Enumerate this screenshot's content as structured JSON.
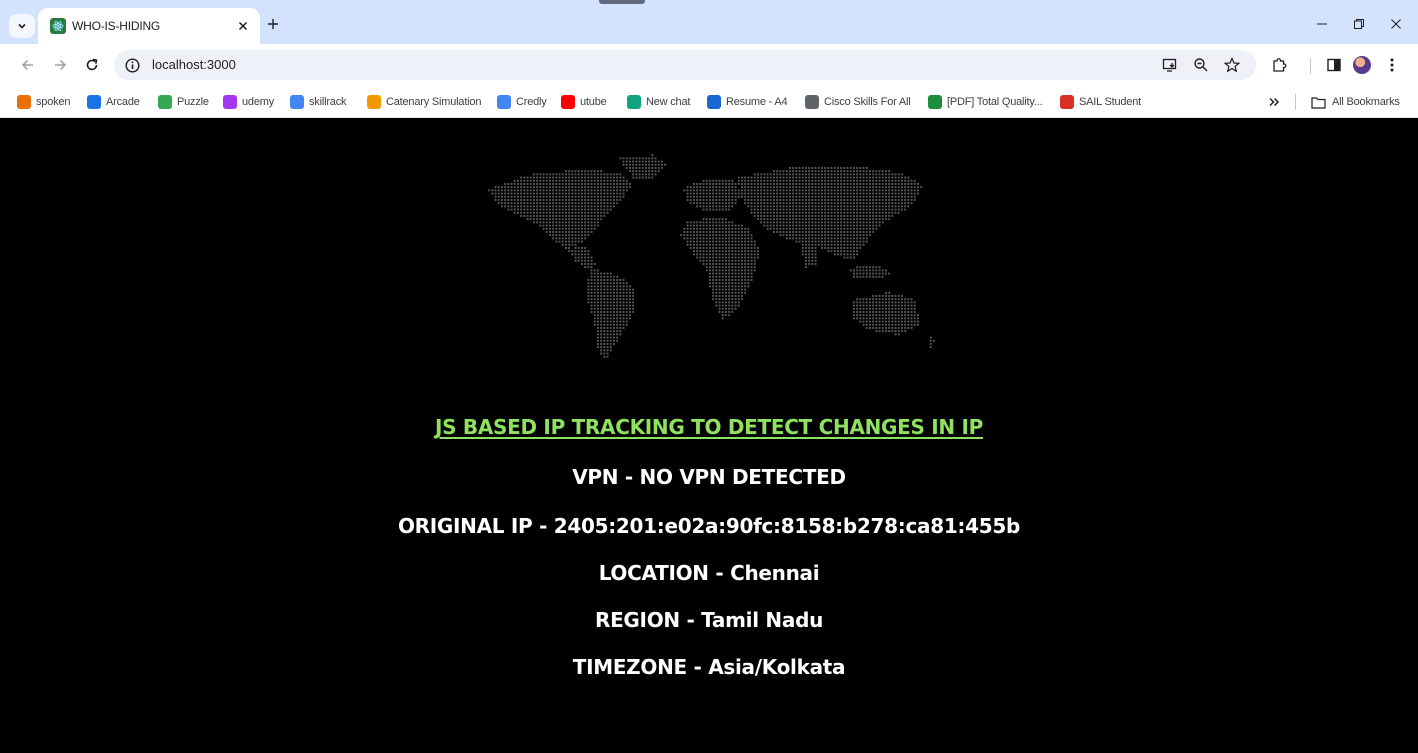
{
  "browser": {
    "tab": {
      "title": "WHO-IS-HIDING"
    },
    "url": "localhost:3000",
    "bookmarks": [
      {
        "label": "spoken",
        "icon": "spoken-icon",
        "color": "#e8710a"
      },
      {
        "label": "Arcade",
        "icon": "arcade-icon",
        "color": "#1a73e8"
      },
      {
        "label": "Puzzle",
        "icon": "puzzle-icon",
        "color": "#34a853"
      },
      {
        "label": "udemy",
        "icon": "udemy-icon",
        "color": "#a435f0"
      },
      {
        "label": "skillrack",
        "icon": "skillrack-icon",
        "color": "#4285f4"
      },
      {
        "label": "Catenary Simulation",
        "icon": "catenary-icon",
        "color": "#f29900"
      },
      {
        "label": "Credly",
        "icon": "google-icon",
        "color": "#4285f4"
      },
      {
        "label": "utube",
        "icon": "youtube-icon",
        "color": "#ff0000"
      },
      {
        "label": "New chat",
        "icon": "chat-icon",
        "color": "#10a37f"
      },
      {
        "label": "Resume - A4",
        "icon": "resume-icon",
        "color": "#1967d2"
      },
      {
        "label": "Cisco Skills For All",
        "icon": "cisco-icon",
        "color": "#5f6368"
      },
      {
        "label": "[PDF] Total Quality...",
        "icon": "pdf-icon",
        "color": "#1e8e3e"
      },
      {
        "label": "SAIL Student",
        "icon": "sail-icon",
        "color": "#d93025"
      }
    ],
    "all_bookmarks_label": "All Bookmarks"
  },
  "page": {
    "headline": "JS BASED IP TRACKING TO DETECT CHANGES IN IP",
    "vpn": "VPN - NO VPN DETECTED",
    "original_ip": "ORIGINAL IP - 2405:201:e02a:90fc:8158:b278:ca81:455b",
    "location": "LOCATION - Chennai",
    "region": "REGION - Tamil Nadu",
    "timezone": "TIMEZONE - Asia/Kolkata",
    "colors": {
      "headline": "#8ee25f",
      "text": "#ffffff",
      "background": "#000000"
    }
  }
}
